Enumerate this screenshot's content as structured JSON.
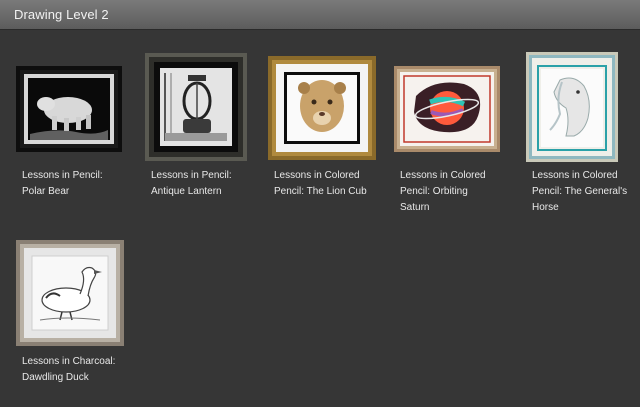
{
  "header": {
    "title": "Drawing Level 2"
  },
  "lessons": [
    {
      "line1": "Lessons in Pencil:",
      "line2": "Polar Bear",
      "line3": ""
    },
    {
      "line1": "Lessons in Pencil:",
      "line2": "Antique Lantern",
      "line3": ""
    },
    {
      "line1": "Lessons in Colored",
      "line2": "Pencil: The Lion Cub",
      "line3": ""
    },
    {
      "line1": "Lessons in Colored",
      "line2": "Pencil: Orbiting",
      "line3": "Saturn"
    },
    {
      "line1": "Lessons in Colored",
      "line2": "Pencil: The General's",
      "line3": "Horse"
    },
    {
      "line1": "Lessons in Charcoal:",
      "line2": "Dawdling Duck",
      "line3": ""
    }
  ]
}
